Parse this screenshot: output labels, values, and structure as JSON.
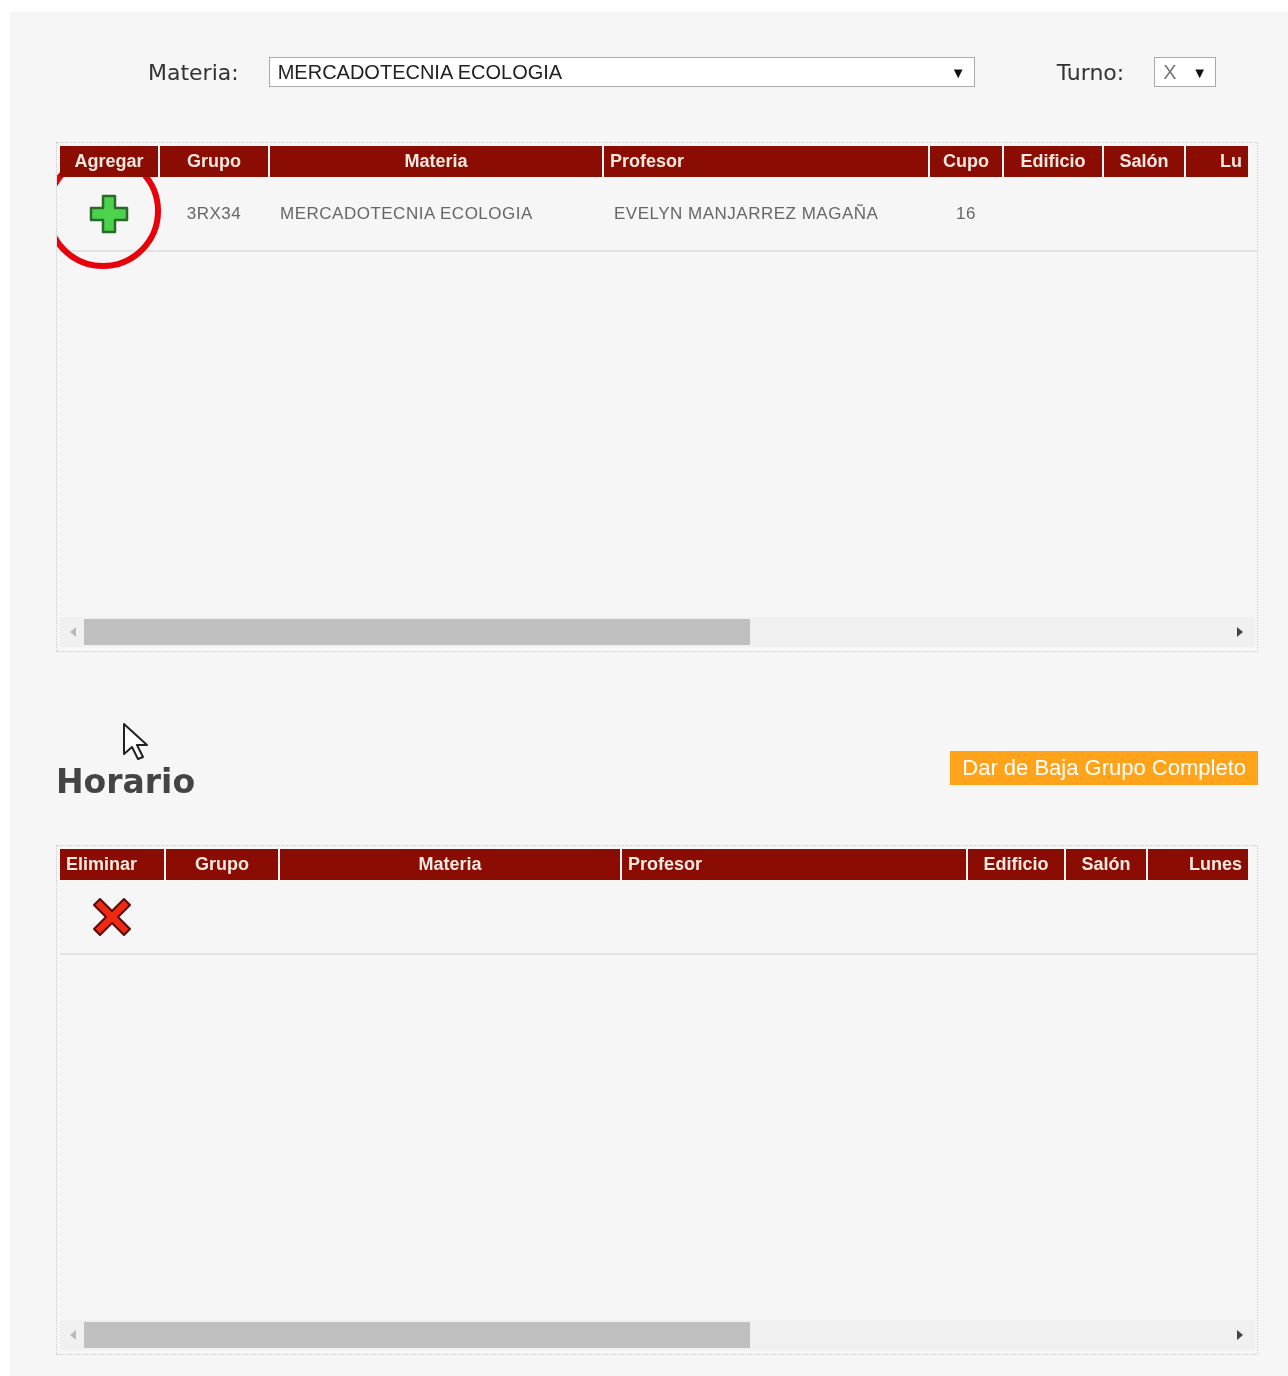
{
  "filters": {
    "materia": {
      "label": "Materia:",
      "value": "MERCADOTECNIA ECOLOGIA",
      "arrow": "▼"
    },
    "turno": {
      "label": "Turno:",
      "value": "X",
      "arrow": "▼"
    }
  },
  "groups_table": {
    "columns": [
      "Agregar",
      "Grupo",
      "Materia",
      "Profesor",
      "Cupo",
      "Edificio",
      "Salón",
      "Lu"
    ],
    "rows": [
      {
        "cells": [
          {
            "kind": "add"
          },
          {
            "kind": "text",
            "text": "3RX34"
          },
          {
            "kind": "text",
            "text": "MERCADOTECNIA ECOLOGIA"
          },
          {
            "kind": "text",
            "text": "EVELYN MANJARREZ MAGAÑA"
          },
          {
            "kind": "text",
            "text": "16"
          }
        ]
      }
    ],
    "highlighted": true
  },
  "schedule": {
    "title": "Horario",
    "drop_button": "Dar de Baja Grupo Completo",
    "table": {
      "columns": [
        "Eliminar",
        "Grupo",
        "Materia",
        "Profesor",
        "Edificio",
        "Salón",
        "Lunes"
      ],
      "rows": [
        {
          "cells": [
            {
              "kind": "delete"
            }
          ]
        }
      ]
    }
  }
}
